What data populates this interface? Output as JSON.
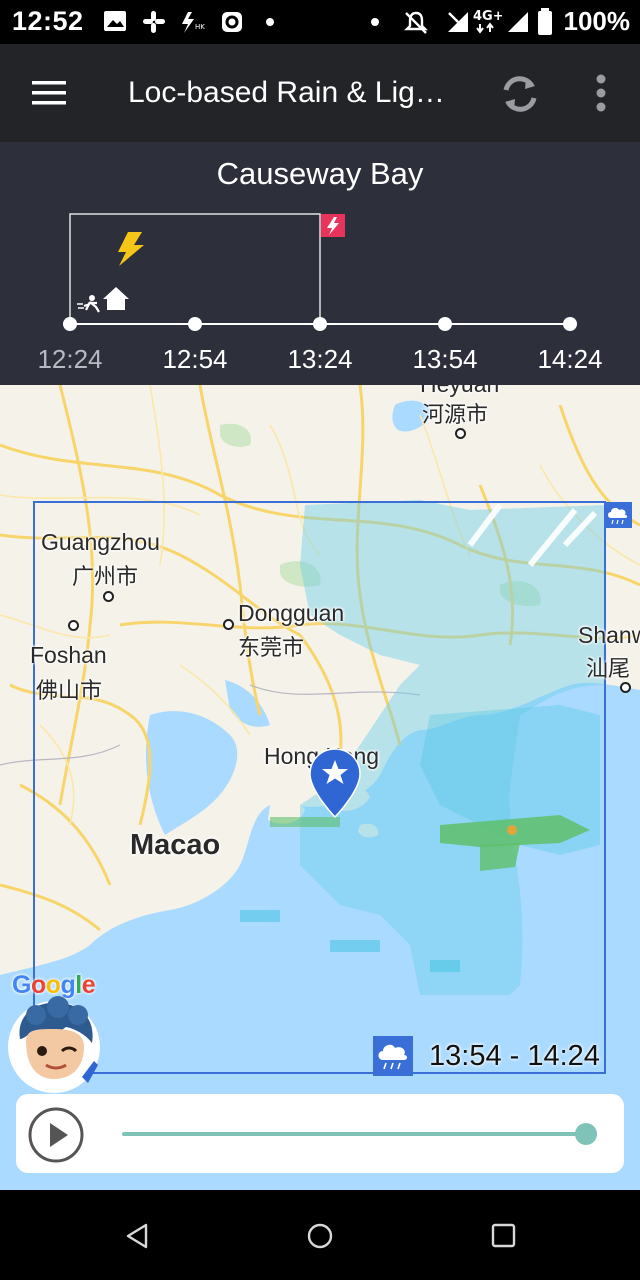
{
  "status_bar": {
    "time": "12:52",
    "battery_percent": "100%",
    "icons": [
      "image-icon",
      "slack-icon",
      "app-notification-icon",
      "cctv-icon",
      "dot-icon",
      "dot-icon",
      "silent-icon",
      "signal-icon",
      "4g-icon",
      "signal-icon",
      "battery-icon"
    ]
  },
  "app_bar": {
    "title": "Loc-based Rain & Lig…",
    "menu_icon": "hamburger-icon",
    "refresh_icon": "refresh-icon",
    "more_icon": "more-vert-icon"
  },
  "timeline": {
    "location": "Causeway Bay",
    "times": [
      "12:24",
      "12:54",
      "13:24",
      "13:54",
      "14:24"
    ],
    "lightning_icon": "lightning-icon",
    "shelter_icon": "run-to-shelter-icon",
    "lightning_badge_icon": "lightning-badge-icon"
  },
  "map": {
    "labels": {
      "heyuan_en": "Heyuan",
      "heyuan_cn": "河源市",
      "guangzhou_en": "Guangzhou",
      "guangzhou_cn": "广州市",
      "dongguan_en": "Dongguan",
      "dongguan_cn": "东莞市",
      "foshan_en": "Foshan",
      "foshan_cn": "佛山市",
      "shanwei_en": "Shanw",
      "shanwei_cn": "汕尾",
      "hongkong_en": "Hong Kong",
      "macao_en": "Macao"
    },
    "google_logo": "Google",
    "rain_icon": "rain-cloud-icon",
    "time_range": "13:54 - 14:24",
    "location_pin_icon": "location-pin-icon"
  },
  "player": {
    "play_icon": "play-icon",
    "progress": 1.0
  },
  "colors": {
    "app_bar": "#232427",
    "timeline_bg": "#2d2f3b",
    "lightning": "#f5c518",
    "badge": "#e8335a",
    "rain_box": "#3a6fd8",
    "slider": "#7fc3b8",
    "pin": "#2f66d4"
  },
  "nav_bar": {
    "back_icon": "back-icon",
    "home_icon": "home-icon",
    "recents_icon": "recents-icon"
  }
}
